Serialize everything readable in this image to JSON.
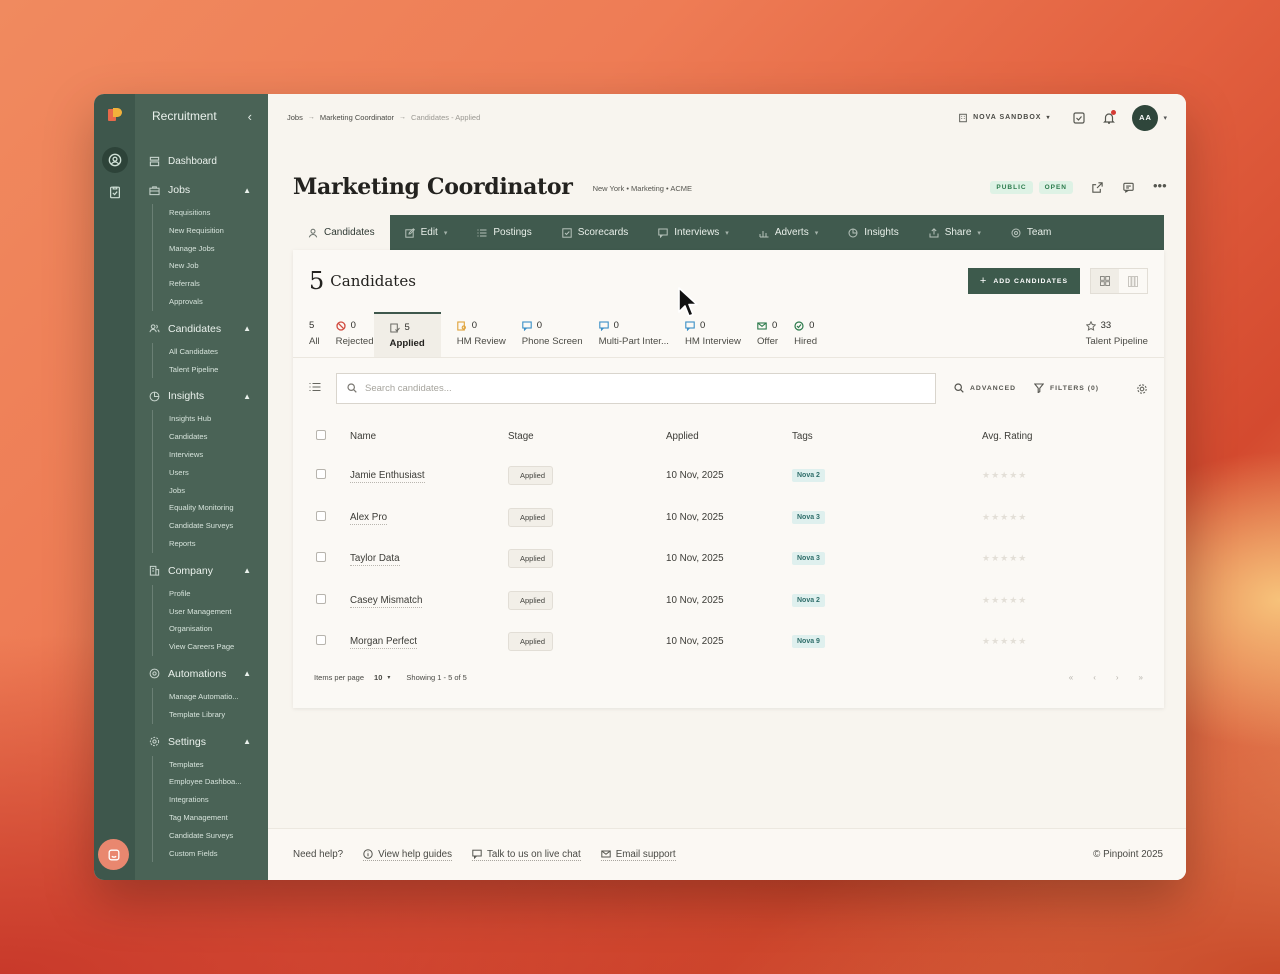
{
  "sidebar": {
    "title": "Recruitment",
    "dashboard": "Dashboard",
    "sections": [
      {
        "label": "Jobs",
        "items": [
          "Requisitions",
          "New Requisition",
          "Manage Jobs",
          "New Job",
          "Referrals",
          "Approvals"
        ]
      },
      {
        "label": "Candidates",
        "items": [
          "All Candidates",
          "Talent Pipeline"
        ]
      },
      {
        "label": "Insights",
        "items": [
          "Insights Hub",
          "Candidates",
          "Interviews",
          "Users",
          "Jobs",
          "Equality Monitoring",
          "Candidate Surveys",
          "Reports"
        ]
      },
      {
        "label": "Company",
        "items": [
          "Profile",
          "User Management",
          "Organisation",
          "View Careers Page"
        ]
      },
      {
        "label": "Automations",
        "items": [
          "Manage Automatio...",
          "Template Library"
        ]
      },
      {
        "label": "Settings",
        "items": [
          "Templates",
          "Employee Dashboa...",
          "Integrations",
          "Tag Management",
          "Candidate Surveys",
          "Custom Fields"
        ]
      }
    ]
  },
  "topbar": {
    "crumbs": [
      "Jobs",
      "Marketing Coordinator",
      "Candidates - Applied"
    ],
    "sandbox": "NOVA SANDBOX",
    "avatar": "AA"
  },
  "job": {
    "title": "Marketing Coordinator",
    "meta": "New York • Marketing • ACME",
    "badge_public": "PUBLIC",
    "badge_open": "OPEN"
  },
  "tabs": [
    "Candidates",
    "Edit",
    "Postings",
    "Scorecards",
    "Interviews",
    "Adverts",
    "Insights",
    "Share",
    "Team"
  ],
  "candidates": {
    "count": "5",
    "label": "Candidates",
    "add_button": "ADD CANDIDATES"
  },
  "stages": [
    {
      "count": "5",
      "name": "All",
      "icon": "none"
    },
    {
      "count": "0",
      "name": "Rejected",
      "icon": "ban-icon"
    },
    {
      "count": "5",
      "name": "Applied",
      "icon": "applied-icon"
    },
    {
      "count": "0",
      "name": "HM Review",
      "icon": "review-icon"
    },
    {
      "count": "0",
      "name": "Phone Screen",
      "icon": "chat-icon"
    },
    {
      "count": "0",
      "name": "Multi-Part Inter...",
      "icon": "chat-icon"
    },
    {
      "count": "0",
      "name": "HM Interview",
      "icon": "chat-icon"
    },
    {
      "count": "0",
      "name": "Offer",
      "icon": "mail-icon"
    },
    {
      "count": "0",
      "name": "Hired",
      "icon": "check-icon"
    },
    {
      "count": "33",
      "name": "Talent Pipeline",
      "icon": "star-icon"
    }
  ],
  "search": {
    "placeholder": "Search candidates...",
    "advanced": "ADVANCED",
    "filters": "FILTERS (0)"
  },
  "table": {
    "headers": [
      "Name",
      "Stage",
      "Applied",
      "Tags",
      "Avg. Rating"
    ],
    "rows": [
      {
        "name": "Jamie Enthusiast",
        "stage": "Applied",
        "applied": "10 Nov, 2025",
        "tag": "Nova 2"
      },
      {
        "name": "Alex Pro",
        "stage": "Applied",
        "applied": "10 Nov, 2025",
        "tag": "Nova 3"
      },
      {
        "name": "Taylor Data",
        "stage": "Applied",
        "applied": "10 Nov, 2025",
        "tag": "Nova 3"
      },
      {
        "name": "Casey Mismatch",
        "stage": "Applied",
        "applied": "10 Nov, 2025",
        "tag": "Nova 2"
      },
      {
        "name": "Morgan Perfect",
        "stage": "Applied",
        "applied": "10 Nov, 2025",
        "tag": "Nova 9"
      }
    ]
  },
  "pager": {
    "items_label": "Items per page",
    "per_page": "10",
    "showing": "Showing 1 - 5 of 5"
  },
  "footer": {
    "help": "Need help?",
    "guides": "View help guides",
    "chat": "Talk to us on live chat",
    "email": "Email support",
    "copyright": "© Pinpoint 2025"
  },
  "colors": {
    "primary": "#3e574c",
    "accent_tag": "#dff0ee",
    "badge_green": "#2b7a4b"
  }
}
